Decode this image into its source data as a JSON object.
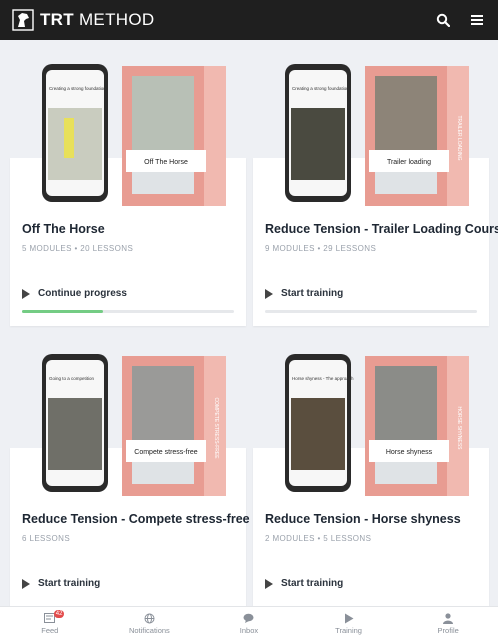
{
  "app": {
    "brand_bold": "TRT",
    "brand_rest": " METHOD",
    "brand_icon": "horse-head-logo"
  },
  "header": {
    "search_icon": "search-icon",
    "menu_icon": "menu-icon"
  },
  "courses": [
    {
      "title": "Off The Horse",
      "meta": "5 MODULES  •  20 LESSONS",
      "action": "Continue progress",
      "progress": 0.38,
      "box_label": "Off The Horse",
      "box_side": "",
      "phone_caption": "Creating a strong foundation"
    },
    {
      "title": "Reduce Tension - Trailer Loading Course",
      "meta": "9 MODULES  •  29 LESSONS",
      "action": "Start training",
      "progress": 0,
      "box_label": "Trailer loading",
      "box_side": "TRAILER LOADING",
      "phone_caption": "Creating a strong foundation"
    },
    {
      "title": "Reduce Tension - Compete stress-free",
      "meta": "6 LESSONS",
      "action": "Start training",
      "progress": 0,
      "box_label": "Compete stress-free",
      "box_side": "COMPETE STRESS-FREE",
      "phone_caption": "Going to a competition"
    },
    {
      "title": "Reduce Tension - Horse shyness",
      "meta": "2 MODULES  •  5 LESSONS",
      "action": "Start training",
      "progress": 0,
      "box_label": "Horse shyness",
      "box_side": "HORSE SHYNESS",
      "phone_caption": "Horse shyness - The approach"
    }
  ],
  "nav": [
    {
      "label": "Feed",
      "icon": "feed-icon",
      "badge": "42"
    },
    {
      "label": "Notifications",
      "icon": "globe-icon",
      "badge": ""
    },
    {
      "label": "Inbox",
      "icon": "chat-bubble-icon",
      "badge": ""
    },
    {
      "label": "Training",
      "icon": "play-icon",
      "badge": ""
    },
    {
      "label": "Profile",
      "icon": "user-icon",
      "badge": ""
    }
  ],
  "colors": {
    "topbar": "#1f1f1f",
    "box_pink": "#e89c92",
    "progress": "#74cc84",
    "badge": "#e34b4b"
  }
}
